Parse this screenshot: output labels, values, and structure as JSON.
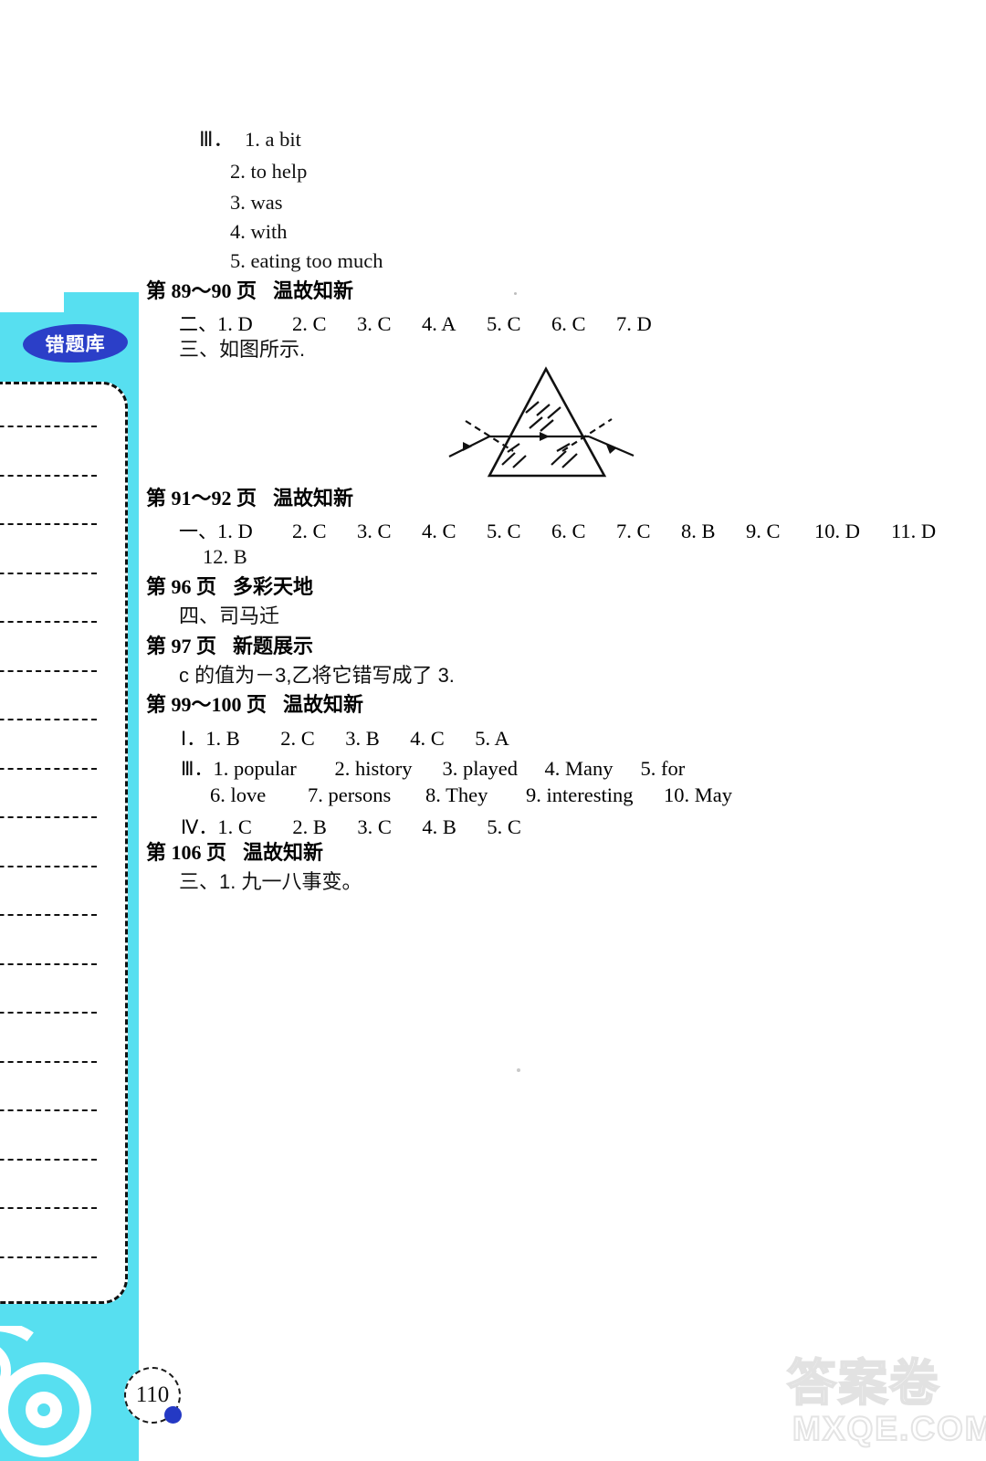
{
  "sidebar": {
    "badge_label": "错题库",
    "note_line_count": 18,
    "tab_color": "#57dff0",
    "badge_color": "#2b3fc8"
  },
  "page_number": "110",
  "watermark": {
    "chinese": "答案卷",
    "domain": "MXQE.COM"
  },
  "answers": {
    "block_a": {
      "label": "Ⅲ．",
      "items": [
        "1. a bit",
        "2. to help",
        "3. was",
        "4. with",
        "5. eating too much"
      ]
    },
    "section_89_90": {
      "page_label": "第 89～90 页",
      "title": "温故知新",
      "rows": [
        {
          "lead": "二、",
          "items": [
            "1. D",
            "2. C",
            "3. C",
            "4. A",
            "5. C",
            "6. C",
            "7. D"
          ]
        },
        {
          "lead": "三、如图所示.",
          "items": []
        }
      ]
    },
    "section_91_92": {
      "page_label": "第 91～92 页",
      "title": "温故知新",
      "rows": [
        {
          "lead": "一、",
          "items": [
            "1. D",
            "2. C",
            "3. C",
            "4. C",
            "5. C",
            "6. C",
            "7. C",
            "8. B",
            "9. C",
            "10. D",
            "11. D"
          ]
        },
        {
          "lead": "",
          "items": [
            "12. B"
          ]
        }
      ]
    },
    "section_96": {
      "page_label": "第 96 页",
      "title": "多彩天地",
      "rows": [
        {
          "lead": "四、司马迁",
          "items": []
        }
      ]
    },
    "section_97": {
      "page_label": "第 97 页",
      "title": "新题展示",
      "rows": [
        {
          "lead": "c 的值为－3,乙将它错写成了 3.",
          "items": []
        }
      ]
    },
    "section_99_100": {
      "page_label": "第 99～100 页",
      "title": "温故知新",
      "rows": [
        {
          "lead": "Ⅰ．",
          "items": [
            "1. B",
            "2. C",
            "3. B",
            "4. C",
            "5. A"
          ]
        },
        {
          "lead": "Ⅲ．",
          "items": [
            "1. popular",
            "2. history",
            "3. played",
            "4. Many",
            "5. for"
          ]
        },
        {
          "lead": "",
          "items": [
            "6. love",
            "7. persons",
            "8. They",
            "9. interesting",
            "10. May"
          ]
        },
        {
          "lead": "Ⅳ．",
          "items": [
            "1. C",
            "2. B",
            "3. C",
            "4. B",
            "5. C"
          ]
        }
      ]
    },
    "section_106": {
      "page_label": "第 106 页",
      "title": "温故知新",
      "rows": [
        {
          "lead": "三、1. 九一八事变。",
          "items": []
        }
      ]
    }
  },
  "diagram": {
    "caption": "三、如图所示.",
    "description": "triangular-prism-light-refraction"
  }
}
